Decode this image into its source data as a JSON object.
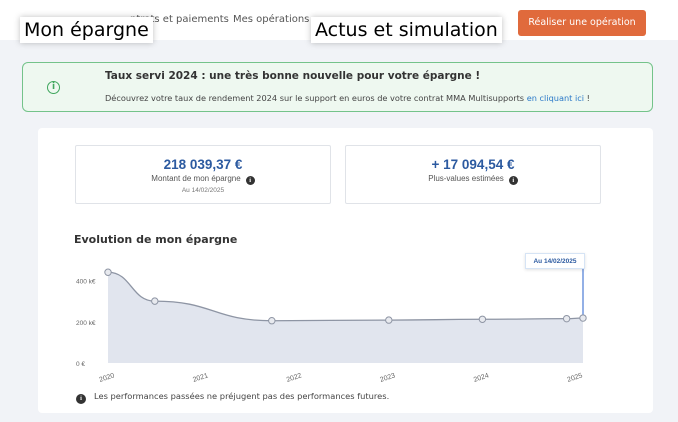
{
  "nav": {
    "contracts": "ntrats et paiements",
    "operations": "Mes opérations",
    "cta": "Réaliser une opération"
  },
  "overlays": {
    "left": "Mon épargne",
    "middle": "Actus et simulation"
  },
  "notice": {
    "icon": "info-circle-icon",
    "title": "Taux servi 2024 : une très bonne nouvelle pour votre épargne !",
    "text": "Découvrez votre taux de rendement 2024 sur le support en euros de votre contrat MMA Multisupports ",
    "link": "en cliquant ici",
    "suffix": " !"
  },
  "kpis": {
    "savings": {
      "value": "218 039,37 €",
      "label": "Montant de mon épargne",
      "date": "Au 14/02/2025"
    },
    "gains": {
      "value": "+ 17 094,54 €",
      "label": "Plus-values estimées"
    }
  },
  "chart_title": "Evolution de mon épargne",
  "date_badge": "Au 14/02/2025",
  "disclaimer": "Les performances passées ne préjugent pas des performances futures.",
  "colors": {
    "accent": "#e06a3c",
    "brand_blue": "#2c5aa0",
    "success": "#3fa65d"
  },
  "chart_data": {
    "type": "area",
    "x": [
      "2020",
      "2020.5",
      "2021.75",
      "2023",
      "2024",
      "2024.9",
      "2025.12"
    ],
    "values": [
      440000,
      300000,
      205000,
      208000,
      212000,
      215000,
      218039
    ],
    "x_ticks": [
      "2020",
      "2021",
      "2022",
      "2023",
      "2024",
      "2025"
    ],
    "y_ticks": [
      "0 €",
      "200 k€",
      "400 k€"
    ],
    "ylim": [
      0,
      480000
    ],
    "highlight_date": "Au 14/02/2025"
  }
}
